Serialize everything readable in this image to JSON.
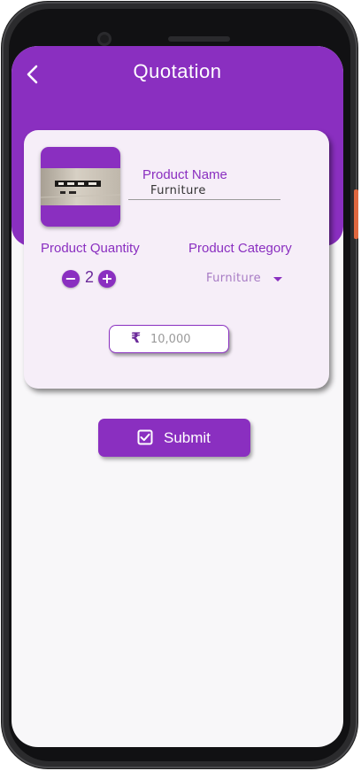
{
  "header": {
    "title": "Quotation"
  },
  "product": {
    "name_label": "Product Name",
    "name_value": "Furniture"
  },
  "quantity": {
    "label": "Product Quantity",
    "value": "2",
    "minus": "−",
    "plus": "+"
  },
  "category": {
    "label": "Product Category",
    "selected": "Furniture"
  },
  "price": {
    "currency": "₹",
    "placeholder": "10,000"
  },
  "submit": {
    "label": "Submit"
  },
  "colors": {
    "primary": "#8a2fc0",
    "card": "#f6eef8",
    "background": "#f8f7f9"
  },
  "icons": {
    "back": "back-arrow-icon",
    "submit": "checkbox-checked-icon",
    "dropdown": "caret-down-icon",
    "currency": "rupee-icon"
  }
}
